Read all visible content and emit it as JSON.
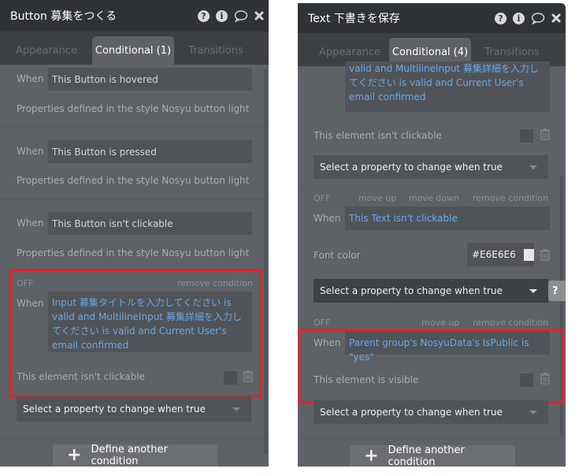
{
  "left_panel": {
    "title": "Button 募集をつくる",
    "tabs": [
      "Appearance",
      "Conditional (1)",
      "Transitions"
    ],
    "active_tab": "Conditional (1)",
    "conditions": [
      {
        "when_label": "When",
        "expression": "This Button is hovered",
        "note": "Properties defined in the style Nosyu button light"
      },
      {
        "when_label": "When",
        "expression": "This Button is pressed",
        "note": "Properties defined in the style Nosyu button light"
      },
      {
        "when_label": "When",
        "expression": "This Button isn't clickable",
        "note": "Properties defined in the style Nosyu button light"
      },
      {
        "off_label": "OFF",
        "remove_label": "remove condition",
        "when_label": "When",
        "expression": "Input 募集タイトルを入力してください is valid and MultilineInput 募集詳細を入力してください is valid and Current User's email confirmed",
        "property": "This element isn't clickable",
        "property_checked": false,
        "select_placeholder": "Select a property to change when true"
      }
    ],
    "define_button": "Define another condition"
  },
  "right_panel": {
    "title": "Text 下書きを保存",
    "tabs": [
      "Appearance",
      "Conditional (4)",
      "Transitions"
    ],
    "active_tab": "Conditional (4)",
    "conditions": [
      {
        "expression_partial": "valid and MultilineInput 募集詳細を入力してください is valid and Current User's email confirmed",
        "property": "This element isn't clickable",
        "property_checked": false,
        "select_placeholder": "Select a property to change when true"
      },
      {
        "off_label": "OFF",
        "move_up_label": "move up",
        "move_down_label": "move down",
        "remove_label": "remove condition",
        "when_label": "When",
        "expression": "This Text isn't clickable",
        "property": "Font color",
        "color_value": "#E6E6E6",
        "select_placeholder": "Select a property to change when true"
      },
      {
        "off_label": "OFF",
        "move_up_label": "move up",
        "remove_label": "remove condition",
        "when_label": "When",
        "expression": "Parent group's NosyuData's IsPublic is \"yes\"",
        "property": "This element is visible",
        "property_checked": false,
        "select_placeholder": "Select a property to change when true"
      }
    ],
    "help_tab_label": "?",
    "define_button": "Define another condition"
  },
  "colors": {
    "panel_bg": "#5e6266",
    "titlebar_bg": "#2f3336",
    "expression_blue": "#6aa6e8",
    "highlight_red": "#e6202a"
  }
}
